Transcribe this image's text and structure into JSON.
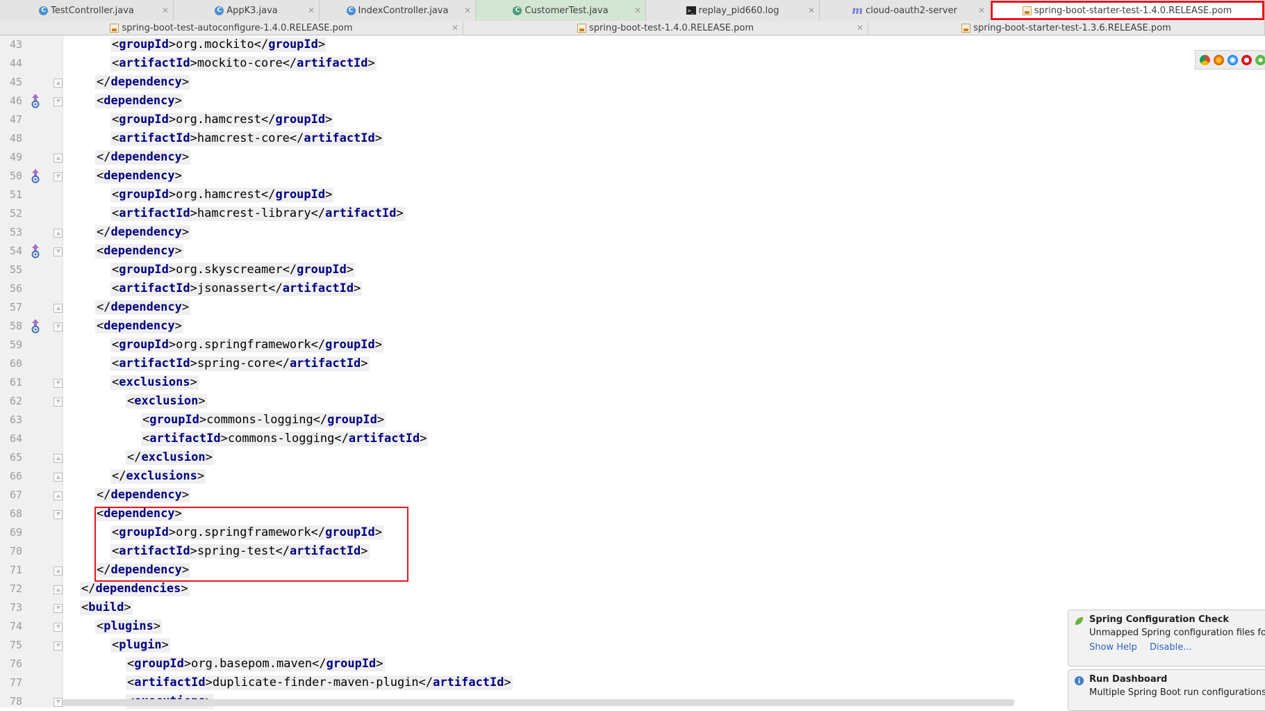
{
  "tabs_row1": [
    {
      "label": "TestController.java",
      "icon": "java-class-icon",
      "state": "normal"
    },
    {
      "label": "AppK3.java",
      "icon": "java-class-icon",
      "state": "normal"
    },
    {
      "label": "IndexController.java",
      "icon": "java-class-icon",
      "state": "normal"
    },
    {
      "label": "CustomerTest.java",
      "icon": "java-test-icon",
      "state": "modified"
    },
    {
      "label": "replay_pid660.log",
      "icon": "log-file-icon",
      "state": "normal"
    },
    {
      "label": "cloud-oauth2-server",
      "icon": "maven-module-icon",
      "state": "normal"
    },
    {
      "label": "spring-boot-starter-test-1.4.0.RELEASE.pom",
      "icon": "pom-file-icon",
      "state": "active-highlighted"
    }
  ],
  "tabs_row2": [
    {
      "label": "spring-boot-test-autoconfigure-1.4.0.RELEASE.pom",
      "icon": "pom-file-icon"
    },
    {
      "label": "spring-boot-test-1.4.0.RELEASE.pom",
      "icon": "pom-file-icon"
    },
    {
      "label": "spring-boot-starter-test-1.3.6.RELEASE.pom",
      "icon": "pom-file-icon"
    }
  ],
  "code_lines": [
    {
      "n": "43",
      "indent": 2,
      "parts": [
        [
          "br",
          "<"
        ],
        [
          "kw",
          "groupId"
        ],
        [
          "br",
          ">"
        ],
        [
          "tx",
          "org.mockito"
        ],
        [
          "br",
          "</"
        ],
        [
          "kw",
          "groupId"
        ],
        [
          "br",
          ">"
        ]
      ]
    },
    {
      "n": "44",
      "indent": 2,
      "parts": [
        [
          "br",
          "<"
        ],
        [
          "kw",
          "artifactId"
        ],
        [
          "br",
          ">"
        ],
        [
          "tx",
          "mockito-core"
        ],
        [
          "br",
          "</"
        ],
        [
          "kw",
          "artifactId"
        ],
        [
          "br",
          ">"
        ]
      ]
    },
    {
      "n": "45",
      "indent": 1,
      "fold": "close",
      "parts": [
        [
          "br",
          "</"
        ],
        [
          "kw",
          "dependency"
        ],
        [
          "br",
          ">"
        ]
      ]
    },
    {
      "n": "46",
      "indent": 1,
      "fold": "open",
      "gutter": "override-up",
      "parts": [
        [
          "br",
          "<"
        ],
        [
          "kw",
          "dependency"
        ],
        [
          "br",
          ">"
        ]
      ]
    },
    {
      "n": "47",
      "indent": 2,
      "parts": [
        [
          "br",
          "<"
        ],
        [
          "kw",
          "groupId"
        ],
        [
          "br",
          ">"
        ],
        [
          "tx",
          "org.hamcrest"
        ],
        [
          "br",
          "</"
        ],
        [
          "kw",
          "groupId"
        ],
        [
          "br",
          ">"
        ]
      ]
    },
    {
      "n": "48",
      "indent": 2,
      "parts": [
        [
          "br",
          "<"
        ],
        [
          "kw",
          "artifactId"
        ],
        [
          "br",
          ">"
        ],
        [
          "tx",
          "hamcrest-core"
        ],
        [
          "br",
          "</"
        ],
        [
          "kw",
          "artifactId"
        ],
        [
          "br",
          ">"
        ]
      ]
    },
    {
      "n": "49",
      "indent": 1,
      "fold": "close",
      "parts": [
        [
          "br",
          "</"
        ],
        [
          "kw",
          "dependency"
        ],
        [
          "br",
          ">"
        ]
      ]
    },
    {
      "n": "50",
      "indent": 1,
      "fold": "open",
      "gutter": "override-up",
      "parts": [
        [
          "br",
          "<"
        ],
        [
          "kw",
          "dependency"
        ],
        [
          "br",
          ">"
        ]
      ]
    },
    {
      "n": "51",
      "indent": 2,
      "parts": [
        [
          "br",
          "<"
        ],
        [
          "kw",
          "groupId"
        ],
        [
          "br",
          ">"
        ],
        [
          "tx",
          "org.hamcrest"
        ],
        [
          "br",
          "</"
        ],
        [
          "kw",
          "groupId"
        ],
        [
          "br",
          ">"
        ]
      ]
    },
    {
      "n": "52",
      "indent": 2,
      "parts": [
        [
          "br",
          "<"
        ],
        [
          "kw",
          "artifactId"
        ],
        [
          "br",
          ">"
        ],
        [
          "tx",
          "hamcrest-library"
        ],
        [
          "br",
          "</"
        ],
        [
          "kw",
          "artifactId"
        ],
        [
          "br",
          ">"
        ]
      ]
    },
    {
      "n": "53",
      "indent": 1,
      "fold": "close",
      "parts": [
        [
          "br",
          "</"
        ],
        [
          "kw",
          "dependency"
        ],
        [
          "br",
          ">"
        ]
      ]
    },
    {
      "n": "54",
      "indent": 1,
      "fold": "open",
      "gutter": "override-up",
      "parts": [
        [
          "br",
          "<"
        ],
        [
          "kw",
          "dependency"
        ],
        [
          "br",
          ">"
        ]
      ]
    },
    {
      "n": "55",
      "indent": 2,
      "parts": [
        [
          "br",
          "<"
        ],
        [
          "kw",
          "groupId"
        ],
        [
          "br",
          ">"
        ],
        [
          "tx",
          "org.skyscreamer"
        ],
        [
          "br",
          "</"
        ],
        [
          "kw",
          "groupId"
        ],
        [
          "br",
          ">"
        ]
      ]
    },
    {
      "n": "56",
      "indent": 2,
      "parts": [
        [
          "br",
          "<"
        ],
        [
          "kw",
          "artifactId"
        ],
        [
          "br",
          ">"
        ],
        [
          "tx",
          "jsonassert"
        ],
        [
          "br",
          "</"
        ],
        [
          "kw",
          "artifactId"
        ],
        [
          "br",
          ">"
        ]
      ]
    },
    {
      "n": "57",
      "indent": 1,
      "fold": "close",
      "parts": [
        [
          "br",
          "</"
        ],
        [
          "kw",
          "dependency"
        ],
        [
          "br",
          ">"
        ]
      ]
    },
    {
      "n": "58",
      "indent": 1,
      "fold": "open",
      "gutter": "override-up",
      "parts": [
        [
          "br",
          "<"
        ],
        [
          "kw",
          "dependency"
        ],
        [
          "br",
          ">"
        ]
      ]
    },
    {
      "n": "59",
      "indent": 2,
      "parts": [
        [
          "br",
          "<"
        ],
        [
          "kw",
          "groupId"
        ],
        [
          "br",
          ">"
        ],
        [
          "tx",
          "org.springframework"
        ],
        [
          "br",
          "</"
        ],
        [
          "kw",
          "groupId"
        ],
        [
          "br",
          ">"
        ]
      ]
    },
    {
      "n": "60",
      "indent": 2,
      "parts": [
        [
          "br",
          "<"
        ],
        [
          "kw",
          "artifactId"
        ],
        [
          "br",
          ">"
        ],
        [
          "tx",
          "spring-core"
        ],
        [
          "br",
          "</"
        ],
        [
          "kw",
          "artifactId"
        ],
        [
          "br",
          ">"
        ]
      ]
    },
    {
      "n": "61",
      "indent": 2,
      "fold": "open",
      "parts": [
        [
          "br",
          "<"
        ],
        [
          "kw",
          "exclusions"
        ],
        [
          "br",
          ">"
        ]
      ]
    },
    {
      "n": "62",
      "indent": 3,
      "fold": "open",
      "parts": [
        [
          "br",
          "<"
        ],
        [
          "kw",
          "exclusion"
        ],
        [
          "br",
          ">"
        ]
      ]
    },
    {
      "n": "63",
      "indent": 4,
      "parts": [
        [
          "br",
          "<"
        ],
        [
          "kw",
          "groupId"
        ],
        [
          "br",
          ">"
        ],
        [
          "tx",
          "commons-logging"
        ],
        [
          "br",
          "</"
        ],
        [
          "kw",
          "groupId"
        ],
        [
          "br",
          ">"
        ]
      ]
    },
    {
      "n": "64",
      "indent": 4,
      "parts": [
        [
          "br",
          "<"
        ],
        [
          "kw",
          "artifactId"
        ],
        [
          "br",
          ">"
        ],
        [
          "tx",
          "commons-logging"
        ],
        [
          "br",
          "</"
        ],
        [
          "kw",
          "artifactId"
        ],
        [
          "br",
          ">"
        ]
      ]
    },
    {
      "n": "65",
      "indent": 3,
      "fold": "close",
      "parts": [
        [
          "br",
          "</"
        ],
        [
          "kw",
          "exclusion"
        ],
        [
          "br",
          ">"
        ]
      ]
    },
    {
      "n": "66",
      "indent": 2,
      "fold": "close",
      "parts": [
        [
          "br",
          "</"
        ],
        [
          "kw",
          "exclusions"
        ],
        [
          "br",
          ">"
        ]
      ]
    },
    {
      "n": "67",
      "indent": 1,
      "fold": "close",
      "parts": [
        [
          "br",
          "</"
        ],
        [
          "kw",
          "dependency"
        ],
        [
          "br",
          ">"
        ]
      ]
    },
    {
      "n": "68",
      "indent": 1,
      "fold": "open",
      "parts": [
        [
          "br",
          "<"
        ],
        [
          "kw",
          "dependency"
        ],
        [
          "br",
          ">"
        ]
      ]
    },
    {
      "n": "69",
      "indent": 2,
      "parts": [
        [
          "br",
          "<"
        ],
        [
          "kw",
          "groupId"
        ],
        [
          "br",
          ">"
        ],
        [
          "tx",
          "org.springframework"
        ],
        [
          "br",
          "</"
        ],
        [
          "kw",
          "groupId"
        ],
        [
          "br",
          ">"
        ]
      ]
    },
    {
      "n": "70",
      "indent": 2,
      "parts": [
        [
          "br",
          "<"
        ],
        [
          "kw",
          "artifactId"
        ],
        [
          "br",
          ">"
        ],
        [
          "tx",
          "spring-test"
        ],
        [
          "br",
          "</"
        ],
        [
          "kw",
          "artifactId"
        ],
        [
          "br",
          ">"
        ]
      ]
    },
    {
      "n": "71",
      "indent": 1,
      "fold": "close",
      "parts": [
        [
          "br",
          "</"
        ],
        [
          "kw",
          "dependency"
        ],
        [
          "br",
          ">"
        ]
      ]
    },
    {
      "n": "72",
      "indent": 0,
      "fold": "close",
      "parts": [
        [
          "br",
          "</"
        ],
        [
          "kw",
          "dependencies"
        ],
        [
          "br",
          ">"
        ]
      ]
    },
    {
      "n": "73",
      "indent": 0,
      "fold": "open",
      "parts": [
        [
          "br",
          "<"
        ],
        [
          "kw",
          "build"
        ],
        [
          "br",
          ">"
        ]
      ]
    },
    {
      "n": "74",
      "indent": 1,
      "fold": "open",
      "parts": [
        [
          "br",
          "<"
        ],
        [
          "kw",
          "plugins"
        ],
        [
          "br",
          ">"
        ]
      ]
    },
    {
      "n": "75",
      "indent": 2,
      "fold": "open",
      "parts": [
        [
          "br",
          "<"
        ],
        [
          "kw",
          "plugin"
        ],
        [
          "br",
          ">"
        ]
      ]
    },
    {
      "n": "76",
      "indent": 3,
      "parts": [
        [
          "br",
          "<"
        ],
        [
          "kw",
          "groupId"
        ],
        [
          "br",
          ">"
        ],
        [
          "tx",
          "org.basepom.maven"
        ],
        [
          "br",
          "</"
        ],
        [
          "kw",
          "groupId"
        ],
        [
          "br",
          ">"
        ]
      ]
    },
    {
      "n": "77",
      "indent": 3,
      "parts": [
        [
          "br",
          "<"
        ],
        [
          "kw",
          "artifactId"
        ],
        [
          "br",
          ">"
        ],
        [
          "tx",
          "duplicate-finder-maven-plugin"
        ],
        [
          "br",
          "</"
        ],
        [
          "kw",
          "artifactId"
        ],
        [
          "br",
          ">"
        ]
      ]
    },
    {
      "n": "78",
      "indent": 3,
      "fold": "open",
      "parts": [
        [
          "br",
          "<"
        ],
        [
          "kw",
          "executions"
        ],
        [
          "br",
          ">"
        ]
      ]
    }
  ],
  "notifications": [
    {
      "title": "Spring Configuration Check",
      "message": "Unmapped Spring configuration files found",
      "links": [
        "Show Help",
        "Disable..."
      ],
      "icon": "spring-leaf-icon"
    },
    {
      "title": "Run Dashboard",
      "message": "Multiple Spring Boot run configurations",
      "links": [],
      "icon": "info-icon"
    }
  ],
  "browser_icons": [
    "chrome-icon",
    "firefox-icon",
    "safari-icon",
    "opera-icon",
    "ie-icon"
  ],
  "colors": {
    "tag": "#000080",
    "highlight_box": "#e8141c",
    "link": "#2d62c7"
  }
}
